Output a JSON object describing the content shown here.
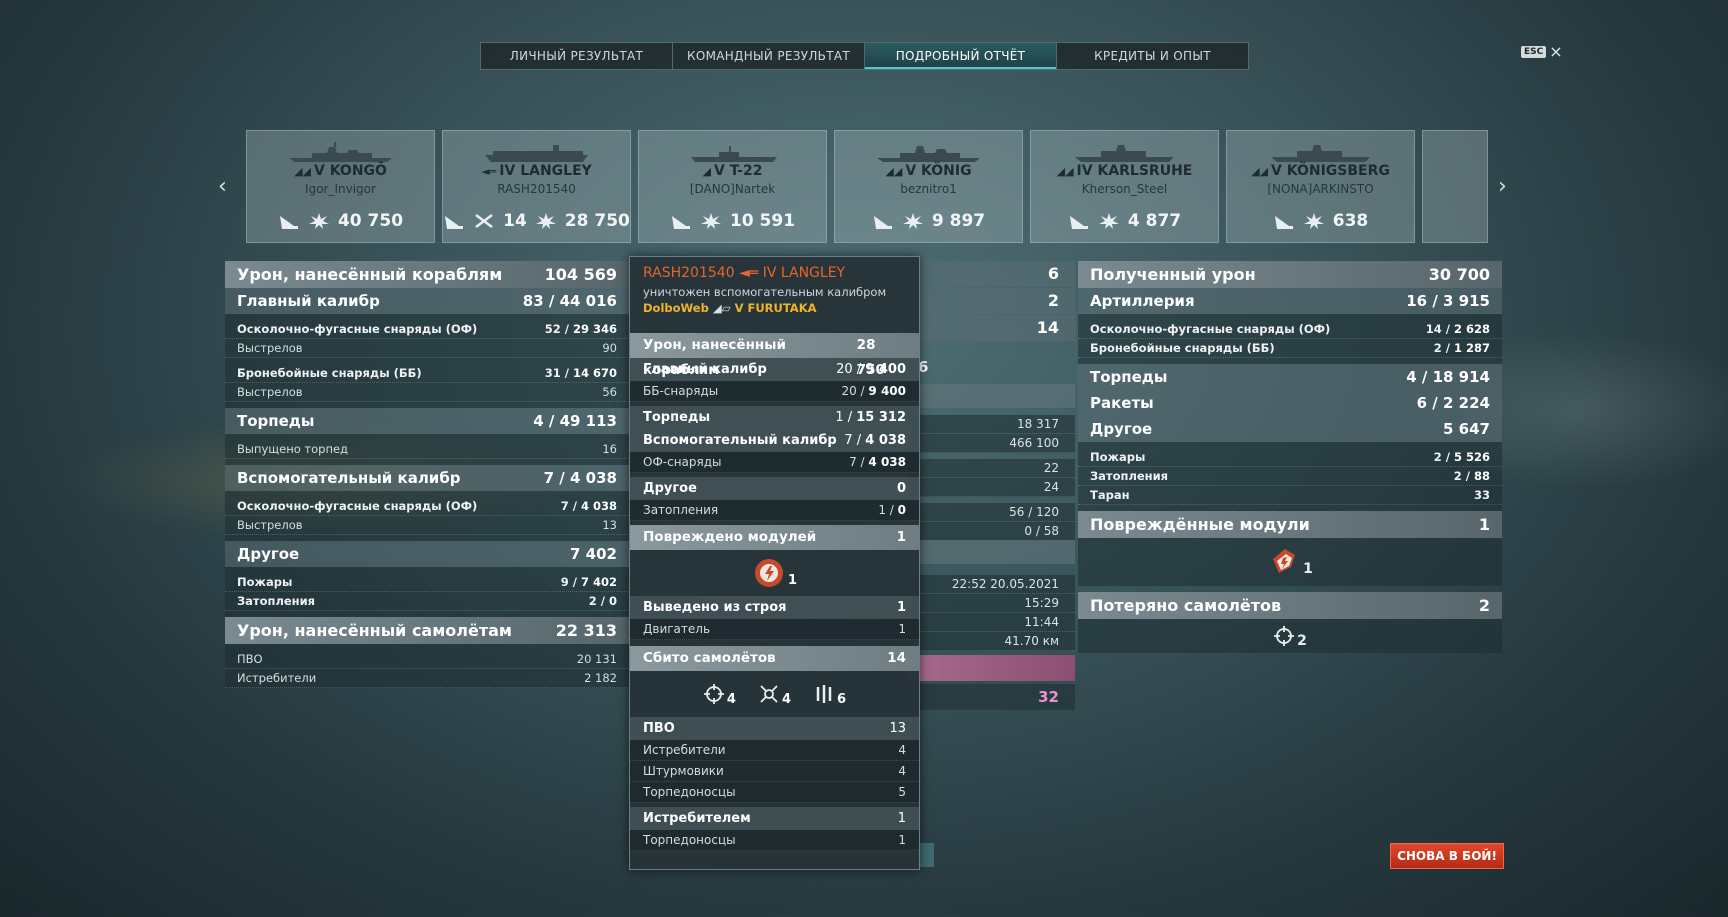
{
  "tabs": [
    {
      "label": "ЛИЧНЫЙ РЕЗУЛЬТАТ"
    },
    {
      "label": "КОМАНДНЫЙ РЕЗУЛЬТАТ"
    },
    {
      "label": "ПОДРОБНЫЙ ОТЧЁТ"
    },
    {
      "label": "КРЕДИТЫ И ОПЫТ"
    }
  ],
  "esc": {
    "badge": "ESC",
    "close": "×"
  },
  "nav": {
    "prev": "‹",
    "next": "›"
  },
  "ships": [
    {
      "name": "V KONGŌ",
      "player": "Igor_Invigor",
      "planes": "",
      "damage": "40 750"
    },
    {
      "name": "IV LANGLEY",
      "player": "RASH201540",
      "planes": "14",
      "damage": "28 750"
    },
    {
      "name": "V T-22",
      "player": "[DANO]Nartek",
      "planes": "",
      "damage": "10 591"
    },
    {
      "name": "V KÖNIG",
      "player": "beznitro1",
      "planes": "",
      "damage": "9 897"
    },
    {
      "name": "IV KARLSRUHE",
      "player": "Kherson_Steel",
      "planes": "",
      "damage": "4 877"
    },
    {
      "name": "V KÖNIGSBERG",
      "player": "[NONA]ARKINSTO",
      "planes": "",
      "damage": "638"
    }
  ],
  "left": {
    "title": "Урон, нанесённый кораблям",
    "title_val": "104 569",
    "main_cal": "Главный калибр",
    "main_cal_val": "83 / ",
    "main_cal_val2": "44 016",
    "he": "Осколочно-фугасные снаряды (ОФ)",
    "he_val": "52 / ",
    "he_val2": "29 346",
    "shots1": "Выстрелов",
    "shots1_val": "90",
    "ap": "Бронебойные снаряды (ББ)",
    "ap_val": "31 / ",
    "ap_val2": "14 670",
    "shots2": "Выстрелов",
    "shots2_val": "56",
    "torp": "Торпеды",
    "torp_val": "4 / ",
    "torp_val2": "49 113",
    "torp_launched": "Выпущено торпед",
    "torp_launched_val": "16",
    "sec": "Вспомогательный калибр",
    "sec_val": "7 / ",
    "sec_val2": "4 038",
    "sec_he": "Осколочно-фугасные снаряды (ОФ)",
    "sec_he_val": "7 / ",
    "sec_he_val2": "4 038",
    "shots3": "Выстрелов",
    "shots3_val": "13",
    "other": "Другое",
    "other_val": "7 402",
    "fires": "Пожары",
    "fires_val": "9 / ",
    "fires_val2": "7 402",
    "flood": "Затопления",
    "flood_val": "2 / ",
    "flood_val2": "0",
    "planes_title": "Урон, нанесённый самолётам",
    "planes_title_val": "22 313",
    "aa": "ПВО",
    "aa_val": "20 131",
    "fighters": "Истребители",
    "fighters_val": "2 182"
  },
  "middle": {
    "v1": "6",
    "v2": "2",
    "v3": "14",
    "v4": "6",
    "l1": "18 317",
    "l2": "466 100",
    "l3": "22",
    "l4": "24",
    "l5": "56 / 120",
    "l6": "0 / 58",
    "d1": "22:52  20.05.2021",
    "d2": "15:29",
    "d3": "11:44",
    "d4": "41.70 км",
    "pink": "32"
  },
  "right": {
    "title": "Полученный урон",
    "title_val": "30 700",
    "art": "Артиллерия",
    "art_val": "16 / ",
    "art_val2": "3 915",
    "he": "Осколочно-фугасные снаряды (ОФ)",
    "he_val": "14 / ",
    "he_val2": "2 628",
    "ap": "Бронебойные снаряды (ББ)",
    "ap_val": "2 / ",
    "ap_val2": "1 287",
    "torp": "Торпеды",
    "torp_val": "4 / ",
    "torp_val2": "18 914",
    "rockets": "Ракеты",
    "rockets_val": "6 / ",
    "rockets_val2": "2 224",
    "other": "Другое",
    "other_val": "5 647",
    "fires": "Пожары",
    "fires_val": "2 / ",
    "fires_val2": "5 526",
    "flood": "Затопления",
    "flood_val": "2 / ",
    "flood_val2": "88",
    "ram": "Таран",
    "ram_val": "33",
    "modules": "Повреждённые модули",
    "modules_val": "1",
    "modules_icon_val": "1",
    "planes_lost": "Потеряно самолётов",
    "planes_lost_val": "2",
    "planes_lost_icon_val": "2"
  },
  "tooltip": {
    "player": "RASH201540",
    "ship": "IV LANGLEY",
    "status": "уничтожен вспомогательным калибром",
    "killer": "DolboWeb",
    "killer_ship": "V FURUTAKA",
    "dmg": "Урон, нанесённый кораблям",
    "dmg_val": "28 750",
    "main": "Главный калибр",
    "main_val": "20 / ",
    "main_val2": "9 400",
    "ap": "ББ-снаряды",
    "ap_val": "20 / ",
    "ap_val2": "9 400",
    "torp": "Торпеды",
    "torp_val": "1 / ",
    "torp_val2": "15 312",
    "sec": "Вспомогательный калибр",
    "sec_val": "7 / ",
    "sec_val2": "4 038",
    "sec_he": "ОФ-снаряды",
    "sec_he_val": "7 / ",
    "sec_he_val2": "4 038",
    "other": "Другое",
    "other_val": "0",
    "flood": "Затопления",
    "flood_val": "1 / ",
    "flood_val2": "0",
    "modules": "Повреждено модулей",
    "modules_val": "1",
    "modules_icon_val": "1",
    "disabled": "Выведено из строя",
    "disabled_val": "1",
    "engine": "Двигатель",
    "engine_val": "1",
    "planes": "Сбито самолётов",
    "planes_val": "14",
    "ic_fighter": "4",
    "ic_attack": "4",
    "ic_torp": "6",
    "aa": "ПВО",
    "aa_val": "13",
    "aa_f": "Истребители",
    "aa_f_val": "4",
    "aa_a": "Штурмовики",
    "aa_a_val": "4",
    "aa_t": "Торпедоносцы",
    "aa_t_val": "5",
    "fighter": "Истребителем",
    "fighter_val": "1",
    "fighter_t": "Торпедоносцы",
    "fighter_t_val": "1"
  },
  "button": {
    "label": "СНОВА В БОЙ!"
  }
}
